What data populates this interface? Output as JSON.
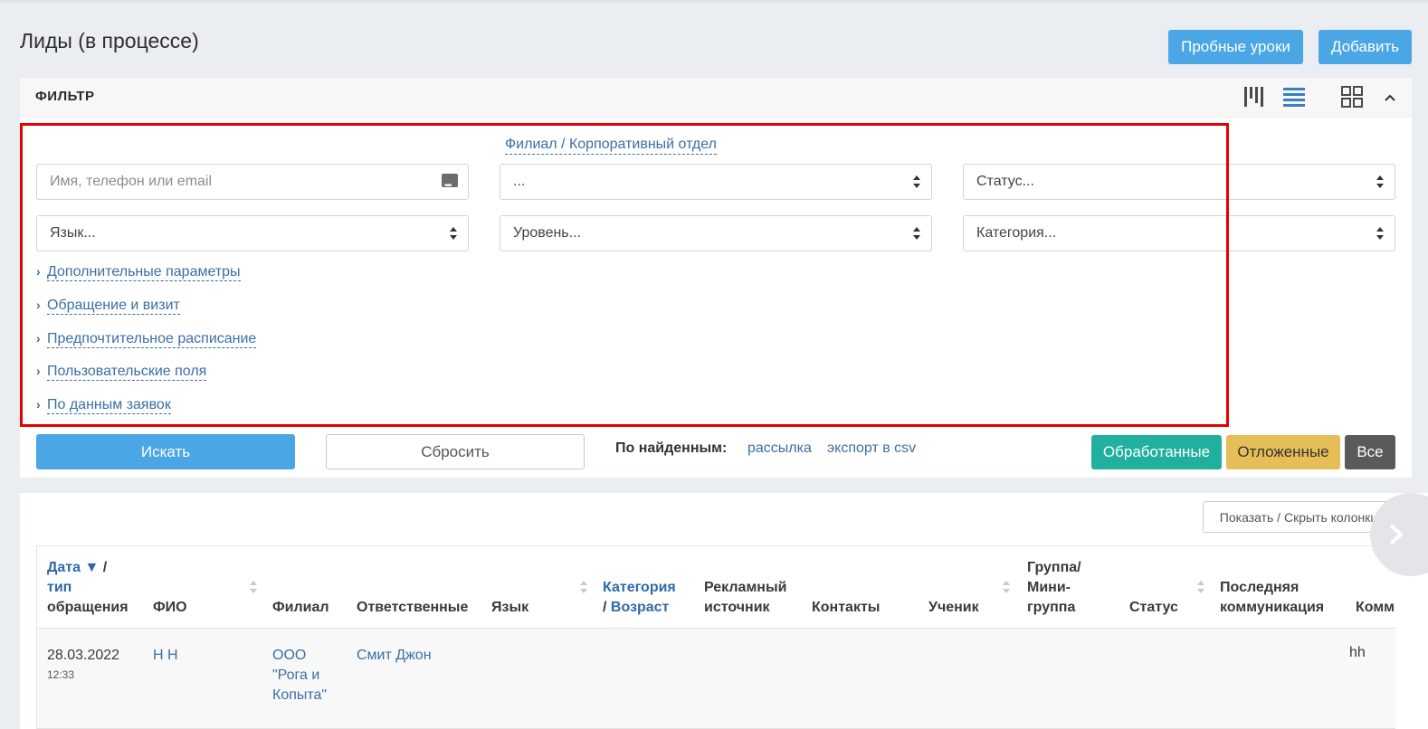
{
  "page": {
    "title": "Лиды (в процессе)",
    "buttons": {
      "trial": "Пробные уроки",
      "add": "Добавить"
    }
  },
  "filter": {
    "title": "ФИЛЬТР",
    "branch_link": "Филиал / Корпоративный отдел",
    "fields": {
      "search_placeholder": "Имя, телефон или email",
      "branch_value": "...",
      "status_value": "Статус...",
      "language_value": "Язык...",
      "level_value": "Уровень...",
      "category_value": "Категория..."
    },
    "expanders": [
      "Дополнительные параметры",
      "Обращение и визит",
      "Предпочтительное расписание",
      "Пользовательские поля",
      "По данным заявок"
    ],
    "search_button": "Искать",
    "reset_button": "Сбросить",
    "found_label": "По найденным:",
    "found_links": [
      "рассылка",
      "экспорт в csv"
    ],
    "status_buttons": {
      "processed": "Обработанные",
      "postponed": "Отложенные",
      "all": "Все"
    },
    "colors": {
      "primary": "#4ba6e6",
      "processed": "#21b09e",
      "postponed": "#e6be57",
      "all": "#5a5a5a",
      "highlight": "#e80000"
    }
  },
  "table": {
    "columns_button": "Показать / Скрыть колонки",
    "headers": {
      "date_1": "Дата",
      "date_sort": "▼",
      "date_slash": "/",
      "date_2": "тип",
      "date_3": "обращения",
      "fio": "ФИО",
      "branch": "Филиал",
      "responsible": "Ответственные",
      "language": "Язык",
      "category_1": "Категория",
      "category_2": "/ ",
      "category_3": "Возраст",
      "ad_1": "Рекламный",
      "ad_2": "источник",
      "contacts": "Контакты",
      "student": "Ученик",
      "group_1": "Группа/",
      "group_2": "Мини-",
      "group_3": "группа",
      "status": "Статус",
      "last_1": "Последняя",
      "last_2": "коммуникация",
      "comment": "Комм"
    },
    "rows": [
      {
        "date": "28.03.2022",
        "time": "12:33",
        "fio": "Н Н",
        "branch_1": "ООО",
        "branch_2": "\"Рога и",
        "branch_3": "Копыта\"",
        "responsible": "Смит Джон",
        "comment": "hh"
      }
    ]
  }
}
